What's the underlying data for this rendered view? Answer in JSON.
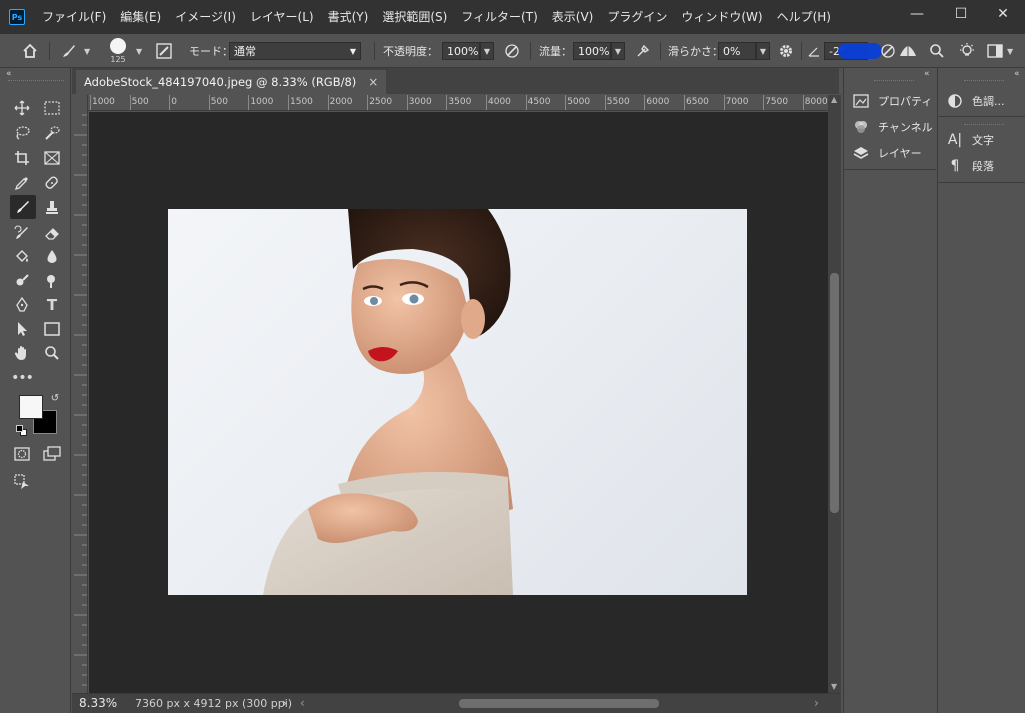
{
  "app": {
    "logo": "Ps"
  },
  "menu": [
    "ファイル(F)",
    "編集(E)",
    "イメージ(I)",
    "レイヤー(L)",
    "書式(Y)",
    "選択範囲(S)",
    "フィルター(T)",
    "表示(V)",
    "プラグイン",
    "ウィンドウ(W)",
    "ヘルプ(H)"
  ],
  "window_controls": {
    "minimize": "—",
    "maximize": "☐",
    "close": "✕"
  },
  "options": {
    "brush_size": "125",
    "mode_label": "モード：",
    "mode_value": "通常",
    "opacity_label": "不透明度：",
    "opacity_value": "100%",
    "flow_label": "流量：",
    "flow_value": "100%",
    "smoothing_label": "滑らかさ：",
    "smoothing_value": "0%",
    "angle_value": "-2°"
  },
  "document": {
    "tab_title": "AdobeStock_484197040.jpeg @ 8.33% (RGB/8)",
    "tab_close": "×",
    "ruler_top": [
      "1000",
      "500",
      "0",
      "500",
      "1000",
      "1500",
      "2000",
      "2500",
      "3000",
      "3500",
      "4000",
      "4500",
      "5000",
      "5500",
      "6000",
      "6500",
      "7000",
      "7500",
      "8000"
    ],
    "zoom": "8.33%",
    "dimensions": "7360 px x 4912 px (300 ppi)"
  },
  "panels_left": [
    {
      "icon": "properties-icon",
      "label": "プロパティ"
    },
    {
      "icon": "channels-icon",
      "label": "チャンネル"
    },
    {
      "icon": "layers-icon",
      "label": "レイヤー"
    }
  ],
  "panels_right": [
    {
      "icon": "adjustments-icon",
      "label": "色調..."
    },
    {
      "icon": "character-icon",
      "label": "文字"
    },
    {
      "icon": "paragraph-icon",
      "label": "段落"
    }
  ],
  "colors": {
    "accent": "#31a8ff",
    "canvas_bg": "#282828",
    "panel_bg": "#535353",
    "menubar_bg": "#323232",
    "selection_blue": "#0a3fd8"
  }
}
